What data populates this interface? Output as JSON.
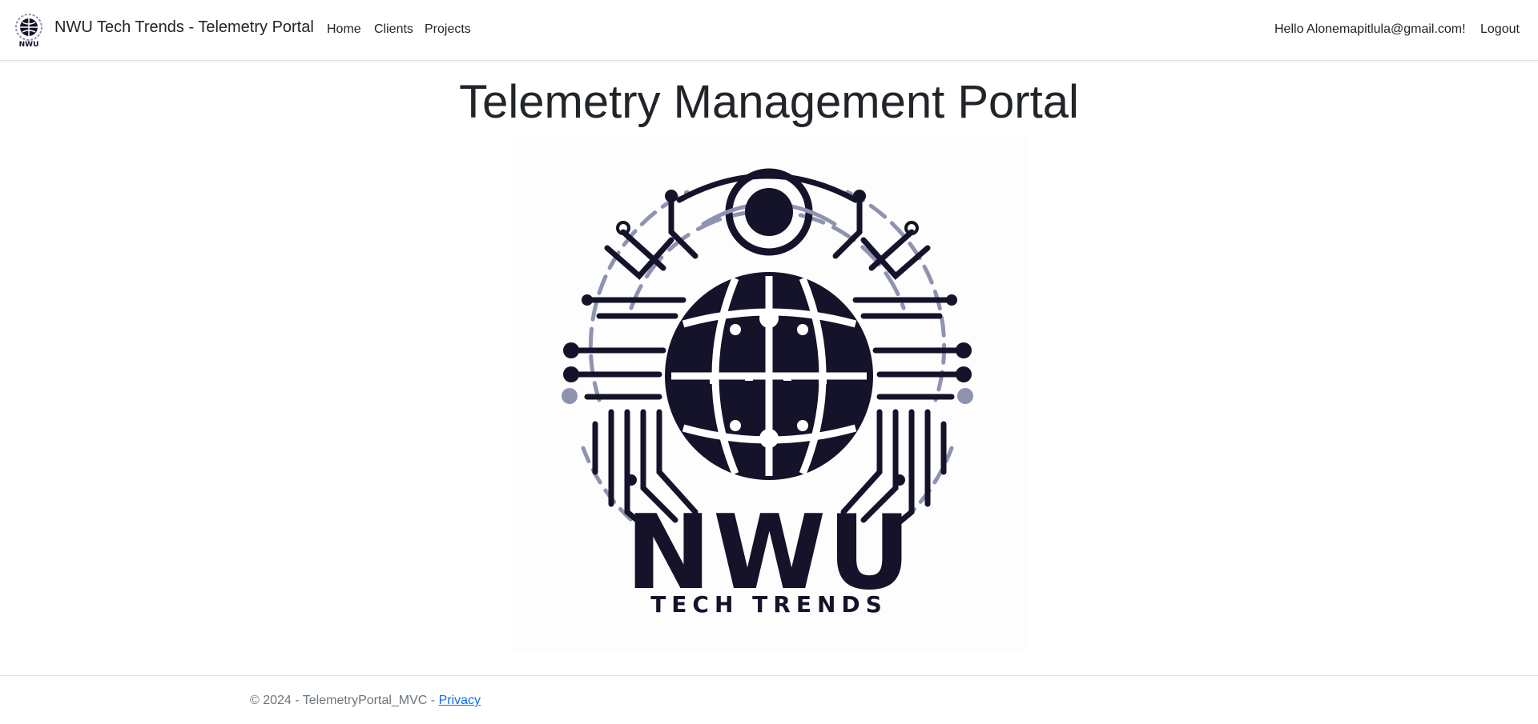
{
  "navbar": {
    "brand": "NWU Tech Trends - Telemetry Portal",
    "brand_logo_text": "NWU",
    "links": [
      "Home",
      "Clients",
      "Projects"
    ],
    "greeting": "Hello Alonemapitlula@gmail.com!",
    "logout": "Logout"
  },
  "main": {
    "title": "Telemetry Management Portal",
    "logo": {
      "name": "NWU",
      "tagline": "TECH TRENDS"
    }
  },
  "footer": {
    "copyright": "© 2024 - TelemetryPortal_MVC - ",
    "privacy_link": "Privacy"
  },
  "colors": {
    "logo_dark": "#14132a",
    "logo_accent": "#8e93b0",
    "link": "#0d6efd",
    "muted": "#6c757d"
  }
}
